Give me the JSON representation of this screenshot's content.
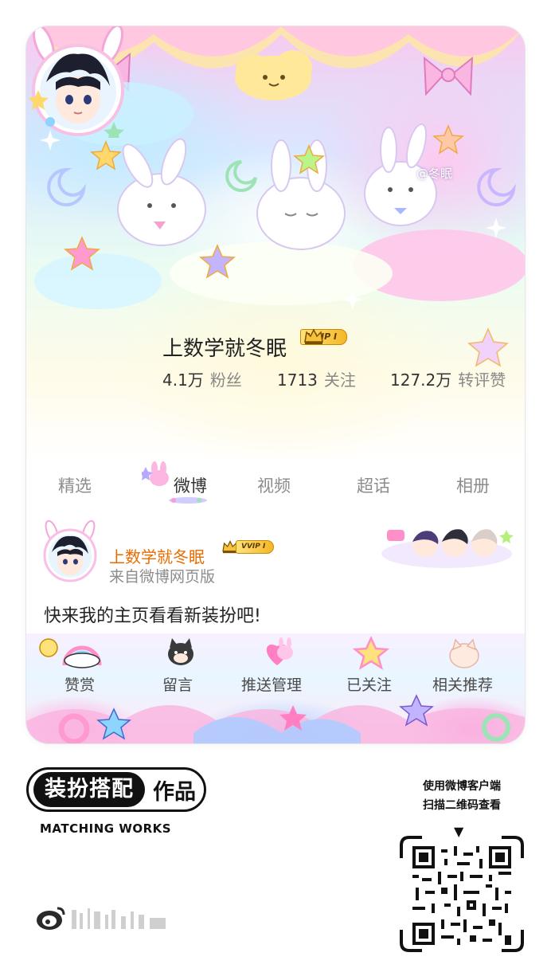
{
  "profile": {
    "watermark": "@冬眠",
    "username": "上数学就冬眠",
    "vip_label": "VVIP Ⅰ",
    "stats": [
      {
        "value": "4.1万",
        "label": "粉丝"
      },
      {
        "value": "1713",
        "label": "关注"
      },
      {
        "value": "127.2万",
        "label": "转评赞"
      }
    ]
  },
  "tabs": [
    {
      "label": "精选",
      "active": false
    },
    {
      "label": "微博",
      "active": true
    },
    {
      "label": "视频",
      "active": false
    },
    {
      "label": "超话",
      "active": false
    },
    {
      "label": "相册",
      "active": false
    }
  ],
  "post": {
    "author": "上数学就冬眠",
    "vip_label": "VVIP Ⅰ",
    "source": "来自微博网页版",
    "content": "快来我的主页看看新装扮吧!"
  },
  "actions": [
    {
      "label": "赞赏",
      "icon": "rainbow-yeah-icon"
    },
    {
      "label": "留言",
      "icon": "cat-face-icon"
    },
    {
      "label": "推送管理",
      "icon": "bunny-heart-icon"
    },
    {
      "label": "已关注",
      "icon": "star-icon"
    },
    {
      "label": "相关推荐",
      "icon": "cat-sticker-icon"
    }
  ],
  "brand": {
    "pill": "装扮搭配",
    "works": "作品",
    "subtitle": "MATCHING WORKS"
  },
  "qr": {
    "caption_line1": "使用微博客户端",
    "caption_line2": "扫描二维码查看",
    "arrow": "▼"
  },
  "colors": {
    "accent_orange": "#e86c00",
    "vip_gold": "#f5b728",
    "text_dark": "#222222",
    "text_muted": "#8c8c8c"
  }
}
